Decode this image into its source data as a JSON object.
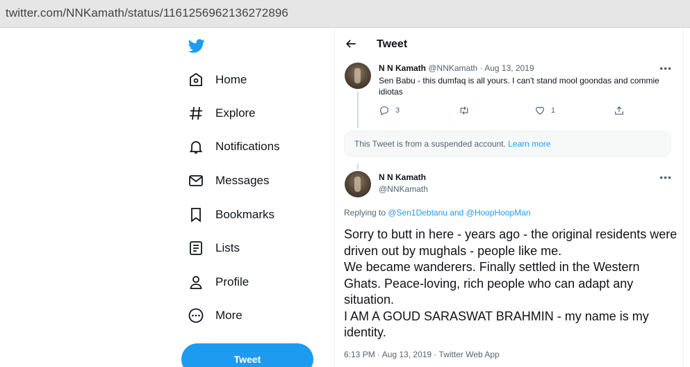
{
  "browser": {
    "url": "twitter.com/NNKamath/status/1161256962136272896"
  },
  "nav": {
    "items": [
      {
        "label": "Home",
        "icon": "home-icon"
      },
      {
        "label": "Explore",
        "icon": "hashtag-icon"
      },
      {
        "label": "Notifications",
        "icon": "bell-icon"
      },
      {
        "label": "Messages",
        "icon": "envelope-icon"
      },
      {
        "label": "Bookmarks",
        "icon": "bookmark-icon"
      },
      {
        "label": "Lists",
        "icon": "list-icon"
      },
      {
        "label": "Profile",
        "icon": "person-icon"
      },
      {
        "label": "More",
        "icon": "more-circle-icon"
      }
    ],
    "tweet_button": "Tweet"
  },
  "header": {
    "title": "Tweet"
  },
  "parent_tweet": {
    "name": "N N Kamath",
    "handle": "@NNKamath",
    "date": "· Aug 13, 2019",
    "text": "Sen Babu - this dumfaq is all yours. I can't stand mool goondas and commie idiotas",
    "replies": "3",
    "retweets": "",
    "likes": "1"
  },
  "suspended": {
    "text": "This Tweet is from a suspended account. ",
    "link": "Learn more"
  },
  "main_tweet": {
    "name": "N N Kamath",
    "handle": "@NNKamath",
    "replying_prefix": "Replying to ",
    "replying_to": "@Sen1Debtanu and @HoopHoopMan",
    "lines": [
      "Sorry to butt in here - years ago - the original residents were driven out by mughals - people like me.",
      "We became wanderers. Finally settled in the Western Ghats. Peace-loving, rich people who can adapt any situation.",
      "I AM A GOUD SARASWAT BRAHMIN - my name is my identity."
    ],
    "meta": "6:13 PM · Aug 13, 2019 · Twitter Web App"
  },
  "colors": {
    "accent": "#1d9bf0",
    "text": "#0f1419",
    "muted": "#536471"
  }
}
